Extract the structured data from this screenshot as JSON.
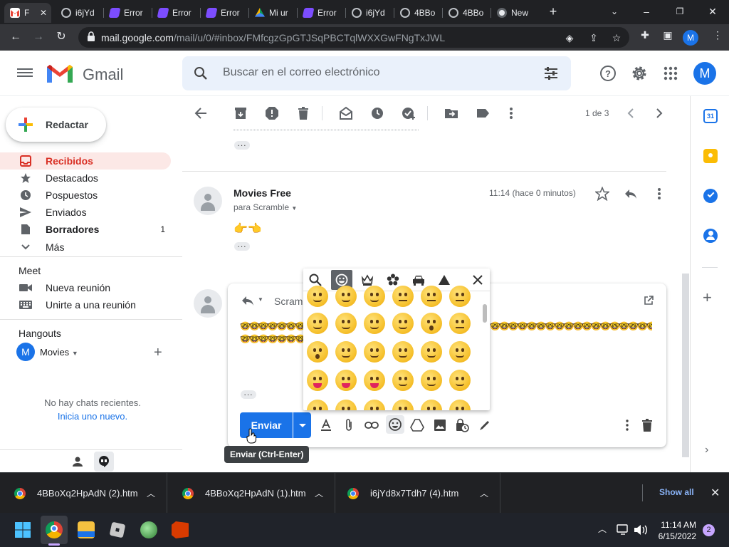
{
  "browser": {
    "tabs": [
      {
        "title": "F",
        "favicon": "gmail-icon",
        "active": true
      },
      {
        "title": "i6jYd",
        "favicon": "globe-icon"
      },
      {
        "title": "Error",
        "favicon": "app-icon"
      },
      {
        "title": "Error",
        "favicon": "app-icon"
      },
      {
        "title": "Error",
        "favicon": "app-icon"
      },
      {
        "title": "Mi ur",
        "favicon": "drive-icon"
      },
      {
        "title": "Error",
        "favicon": "app-icon"
      },
      {
        "title": "i6jYd",
        "favicon": "globe-icon"
      },
      {
        "title": "4BBo",
        "favicon": "globe-icon"
      },
      {
        "title": "4BBo",
        "favicon": "globe-icon"
      },
      {
        "title": "New",
        "favicon": "chrome-icon"
      }
    ],
    "url_host": "mail.google.com",
    "url_path": "/mail/u/0/#inbox/FMfcgzGpGTJSqPBCTqlWXXGwFNgTxJWL",
    "profile_initial": "M"
  },
  "gmail": {
    "product_name": "Gmail",
    "search_placeholder": "Buscar en el correo electrónico",
    "account_initial": "M",
    "compose_label": "Redactar",
    "nav": [
      {
        "label": "Recibidos",
        "icon": "inbox-icon",
        "active": true
      },
      {
        "label": "Destacados",
        "icon": "star-icon"
      },
      {
        "label": "Pospuestos",
        "icon": "clock-icon"
      },
      {
        "label": "Enviados",
        "icon": "send-icon"
      },
      {
        "label": "Borradores",
        "icon": "draft-icon",
        "count": "1",
        "bold": true
      },
      {
        "label": "Más",
        "icon": "chevron-down-icon"
      }
    ],
    "meet": {
      "title": "Meet",
      "items": [
        {
          "label": "Nueva reunión",
          "icon": "video-icon"
        },
        {
          "label": "Unirte a una reunión",
          "icon": "keyboard-icon"
        }
      ]
    },
    "hangouts": {
      "title": "Hangouts",
      "user_initial": "M",
      "user_name": "Movies",
      "no_chats": "No hay chats recientes.",
      "start_new": "Inicia uno nuevo."
    },
    "pager": "1 de 3",
    "message": {
      "sender": "Movies Free",
      "to": "para Scramble",
      "time": "11:14 (hace 0 minutos)",
      "body": "👉👈"
    },
    "reply": {
      "recipient": "Scram",
      "send_label": "Enviar",
      "tooltip": "Enviar (Ctrl-Enter)",
      "body_emoji": "🤓"
    }
  },
  "downloads": {
    "items": [
      {
        "name": "4BBoXq2HpAdN (2).htm"
      },
      {
        "name": "4BBoXq2HpAdN (1).htm"
      },
      {
        "name": "i6jYd8x7Tdh7 (4).htm"
      }
    ],
    "show_all": "Show all"
  },
  "taskbar": {
    "time": "11:14 AM",
    "date": "6/15/2022",
    "notifications": "2"
  },
  "colors": {
    "accent": "#1a73e8",
    "inbox_active_bg": "#fce8e6",
    "inbox_active_text": "#d93025"
  }
}
